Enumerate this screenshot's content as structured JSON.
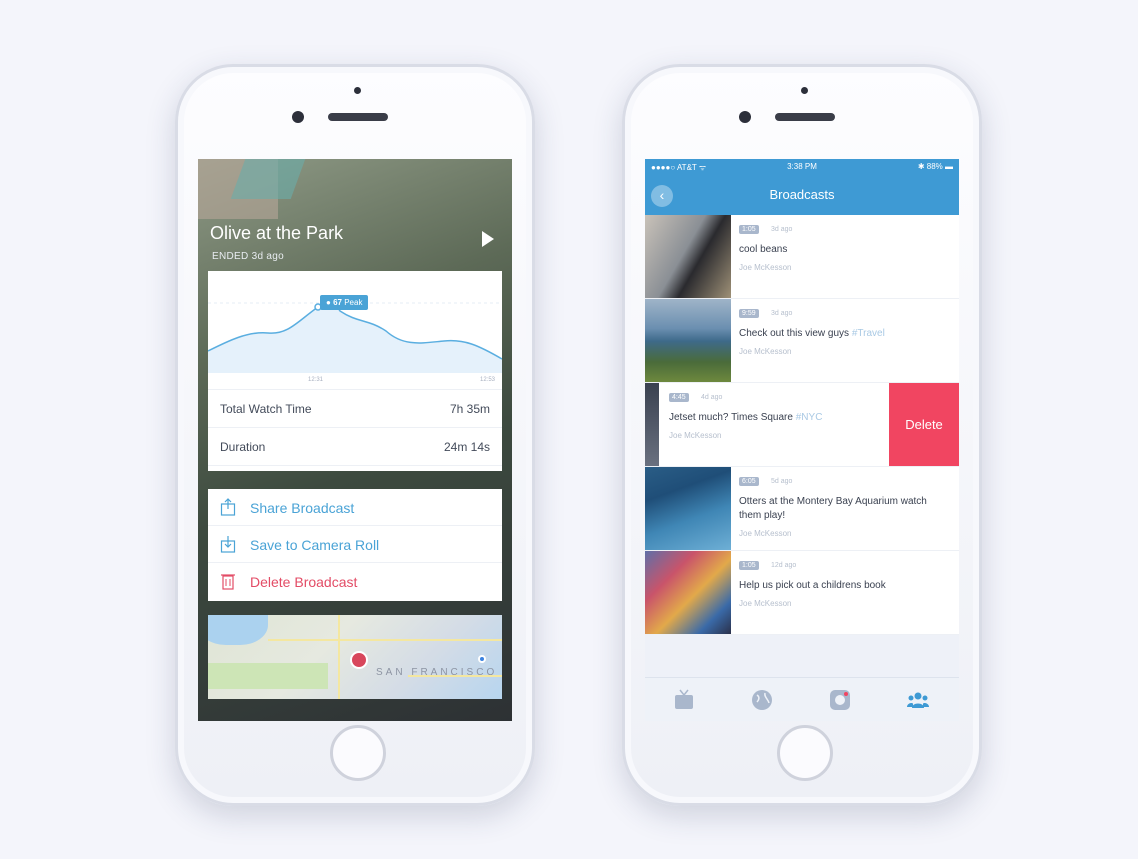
{
  "left_screen": {
    "broadcast_title": "Olive at the Park",
    "broadcast_status": "ENDED 3d ago",
    "chart_peak": {
      "count": "67",
      "label": "Peak"
    },
    "chart_ticks": [
      "12:31",
      "12:53"
    ],
    "stats": [
      {
        "label": "Total Watch Time",
        "value": "7h 35m"
      },
      {
        "label": "Duration",
        "value": "24m 14s"
      }
    ],
    "actions": [
      {
        "label": "Share Broadcast",
        "icon": "share-icon",
        "color": "#4aa3d6"
      },
      {
        "label": "Save to Camera Roll",
        "icon": "download-icon",
        "color": "#4aa3d6"
      },
      {
        "label": "Delete Broadcast",
        "icon": "trash-icon",
        "color": "#e34c66"
      }
    ],
    "map_label": "SAN FRANCISCO"
  },
  "right_screen": {
    "status": {
      "carrier": "●●●●○ AT&T ᯤ",
      "time": "3:38 PM",
      "battery": "✱ 88% ▬"
    },
    "nav_title": "Broadcasts",
    "back_icon": "‹",
    "broadcasts": [
      {
        "duration": "1:05",
        "ago": "3d ago",
        "title": "cool beans",
        "tag": "",
        "user": "Joe McKesson"
      },
      {
        "duration": "9:59",
        "ago": "3d ago",
        "title": "Check out this view guys",
        "tag": "#Travel",
        "user": "Joe McKesson"
      },
      {
        "duration": "4:45",
        "ago": "4d ago",
        "title": "Jetset much? Times Square",
        "tag": "#NYC",
        "user": "Joe McKesson"
      },
      {
        "duration": "6:05",
        "ago": "5d ago",
        "title": "Otters at the Montery Bay Aquarium watch them play!",
        "tag": "",
        "user": "Joe McKesson"
      },
      {
        "duration": "1:05",
        "ago": "12d ago",
        "title": "Help us pick out a childrens book",
        "tag": "",
        "user": "Joe McKesson"
      }
    ],
    "delete_label": "Delete",
    "tabs": [
      {
        "icon": "tv-icon"
      },
      {
        "icon": "globe-icon"
      },
      {
        "icon": "camera-icon"
      },
      {
        "icon": "people-icon"
      }
    ]
  },
  "colors": {
    "accent": "#3e9ad4",
    "delete": "#f14561",
    "destructive_text": "#e34c66"
  }
}
